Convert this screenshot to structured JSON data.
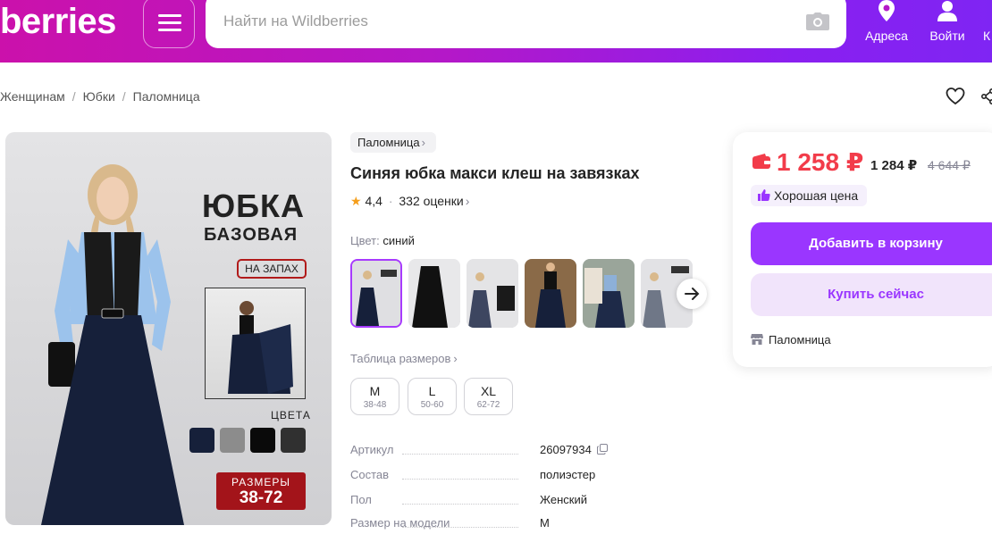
{
  "header": {
    "logo": "berries",
    "search_placeholder": "Найти на Wildberries",
    "nav": [
      {
        "label": "Адреса",
        "icon": "location-pin-icon"
      },
      {
        "label": "Войти",
        "icon": "user-icon"
      },
      {
        "label": "К",
        "icon": "cart-icon"
      }
    ]
  },
  "breadcrumb": [
    "Женщинам",
    "Юбки",
    "Паломница"
  ],
  "gallery": {
    "title_line1": "ЮБКА",
    "title_line2": "БАЗОВАЯ",
    "badge": "НА ЗАПАХ",
    "colors_label": "ЦВЕТА",
    "swatches": [
      "#16203a",
      "#8c8c8c",
      "#0a0a0a",
      "#303030"
    ],
    "size_label": "РАЗМЕРЫ",
    "size_range": "38-72"
  },
  "product": {
    "brand": "Паломница",
    "title": "Синяя юбка макси клеш на завязках",
    "rating": "4,4",
    "reviews": "332 оценки",
    "color_label": "Цвет:",
    "color_value": "синий",
    "size_table_label": "Таблица размеров",
    "sizes": [
      {
        "size": "M",
        "range": "38-48"
      },
      {
        "size": "L",
        "range": "50-60"
      },
      {
        "size": "XL",
        "range": "62-72"
      }
    ],
    "specs": [
      {
        "key": "Артикул",
        "value": "26097934"
      },
      {
        "key": "Состав",
        "value": "полиэстер"
      },
      {
        "key": "Пол",
        "value": "Женский"
      },
      {
        "key": "Размер на модели",
        "value": "M"
      }
    ]
  },
  "buy": {
    "price_wallet": "1 258 ₽",
    "price": "1 284 ₽",
    "price_old": "4 644 ₽",
    "good_price": "Хорошая цена",
    "add_to_cart": "Добавить в корзину",
    "buy_now": "Купить сейчас",
    "seller": "Паломница"
  },
  "colors": {
    "accent": "#9a36ff",
    "price_red": "#f23c4a",
    "header_start": "#cb11ab",
    "header_end": "#7f25f3"
  }
}
